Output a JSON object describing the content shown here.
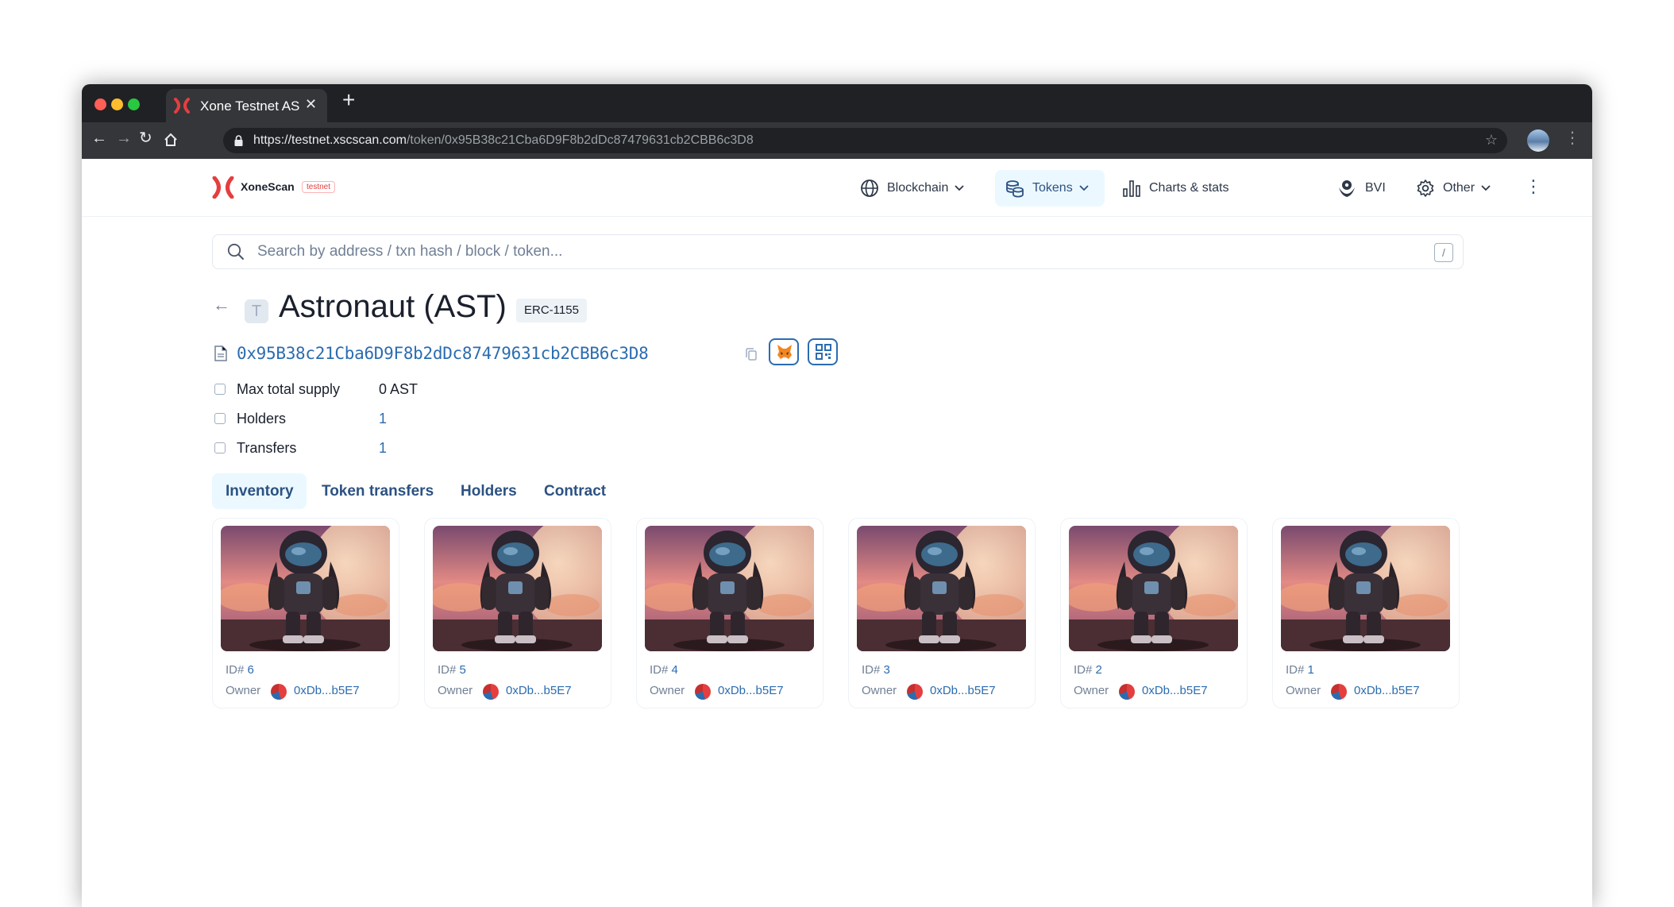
{
  "browser": {
    "tab_title": "Xone Testnet AS",
    "url_host": "https://testnet.xscscan.com",
    "url_path": "/token/0x95B38c21Cba6D9F8b2dDc87479631cb2CBB6c3D8"
  },
  "header": {
    "logo_name": "XoneScan",
    "logo_badge": "testnet",
    "nav": [
      {
        "label": "Blockchain",
        "icon": "globe-icon"
      },
      {
        "label": "Tokens",
        "icon": "coins-icon"
      },
      {
        "label": "Charts & stats",
        "icon": "bar-chart-icon"
      },
      {
        "label": "BVI",
        "icon": "bvi-icon"
      },
      {
        "label": "Other",
        "icon": "gear-icon"
      }
    ]
  },
  "search": {
    "placeholder": "Search by address / txn hash / block / token...",
    "shortcut": "/"
  },
  "token": {
    "icon_letter": "T",
    "title": "Astronaut (AST)",
    "standard": "ERC-1155",
    "address": "0x95B38c21Cba6D9F8b2dDc87479631cb2CBB6c3D8"
  },
  "properties": [
    {
      "label": "Max total supply",
      "value": "0 AST"
    },
    {
      "label": "Holders",
      "value": "1"
    },
    {
      "label": "Transfers",
      "value": "1"
    }
  ],
  "tabs": [
    "Inventory",
    "Token transfers",
    "Holders",
    "Contract"
  ],
  "inventory": [
    {
      "id_label": "ID#",
      "id": "6",
      "owner_label": "Owner",
      "owner": "0xDb...b5E7"
    },
    {
      "id_label": "ID#",
      "id": "5",
      "owner_label": "Owner",
      "owner": "0xDb...b5E7"
    },
    {
      "id_label": "ID#",
      "id": "4",
      "owner_label": "Owner",
      "owner": "0xDb...b5E7"
    },
    {
      "id_label": "ID#",
      "id": "3",
      "owner_label": "Owner",
      "owner": "0xDb...b5E7"
    },
    {
      "id_label": "ID#",
      "id": "2",
      "owner_label": "Owner",
      "owner": "0xDb...b5E7"
    },
    {
      "id_label": "ID#",
      "id": "1",
      "owner_label": "Owner",
      "owner": "0xDb...b5E7"
    }
  ],
  "colors": {
    "brand": "#e53e3e",
    "link": "#2b6cb0",
    "active_tab_bg": "#ebf8ff"
  }
}
